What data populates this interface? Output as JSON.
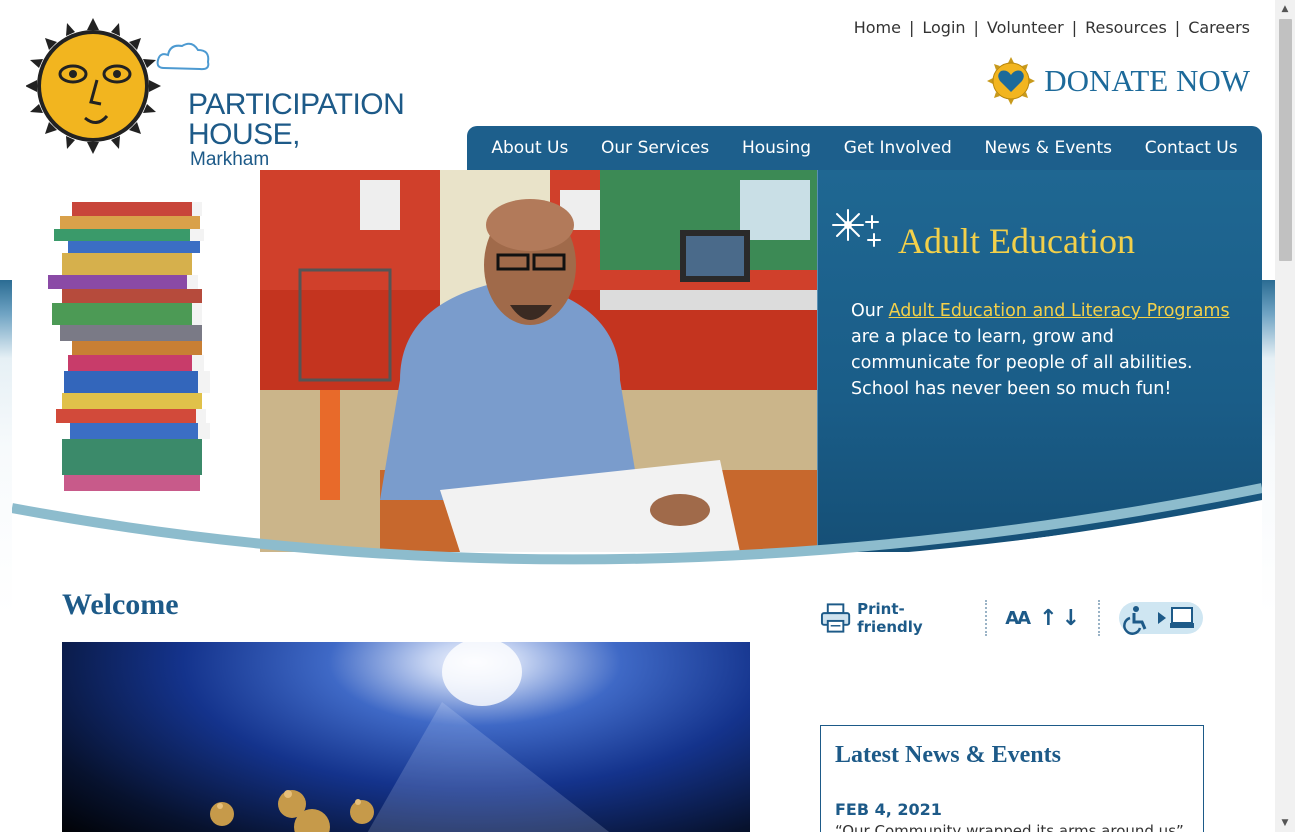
{
  "site": {
    "name": "PARTICIPATION HOUSE,",
    "location": "Markham"
  },
  "top_links": [
    "Home",
    "Login",
    "Volunteer",
    "Resources",
    "Careers"
  ],
  "donate": {
    "label": "DONATE NOW",
    "icon": "heart-sun-icon"
  },
  "nav": [
    "About Us",
    "Our Services",
    "Housing",
    "Get Involved",
    "News & Events",
    "Contact Us"
  ],
  "hero": {
    "title": "Adult Education",
    "intro": "Our ",
    "link": "Adult Education and Literacy Programs",
    "body": " are a place to learn, grow and communicate for people of all abilities. School has never been so much fun!"
  },
  "welcome": {
    "heading": "Welcome"
  },
  "tools": {
    "print_label": "Print-friendly",
    "font_label": "AA",
    "font_up": "↑",
    "font_down": "↓"
  },
  "news": {
    "title": "Latest News & Events",
    "date": "FEB 4, 2021",
    "excerpt": "“Our Community wrapped its arms around us”"
  },
  "colors": {
    "brand_blue": "#1d5a88",
    "nav_blue": "#1d5f8c",
    "accent_yellow": "#f3d04a",
    "sun_yellow": "#f2b51f"
  }
}
